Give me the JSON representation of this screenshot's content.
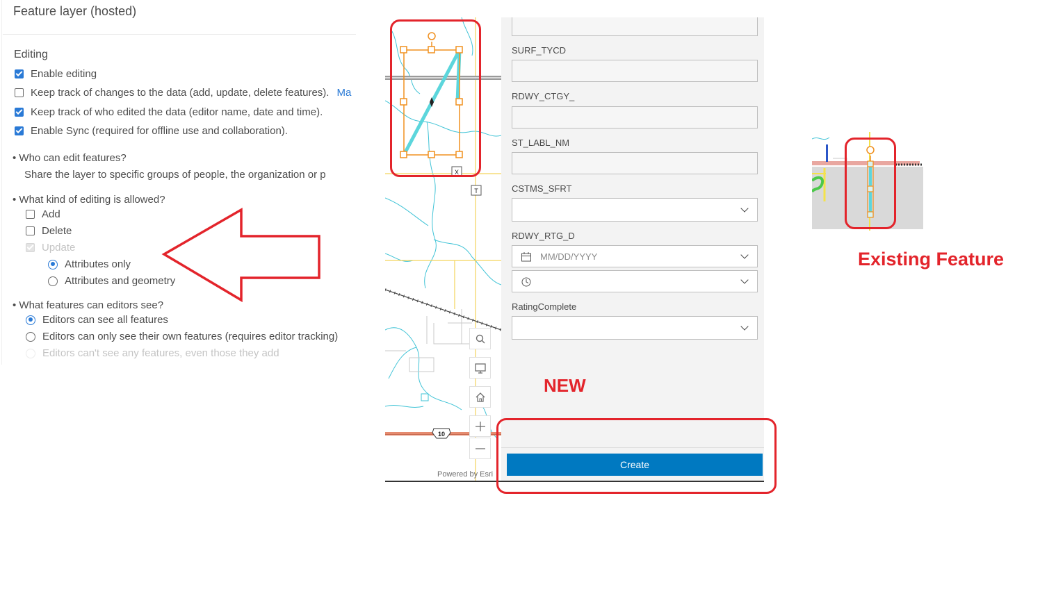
{
  "settings": {
    "title": "Feature layer (hosted)",
    "editing_heading": "Editing",
    "enable_editing": "Enable editing",
    "track_changes": "Keep track of changes to the data (add, update, delete features).",
    "track_changes_link": "Ma",
    "track_editor": "Keep track of who edited the data (editor name, date and time).",
    "enable_sync": "Enable Sync (required for offline use and collaboration).",
    "who_heading": "• Who can edit features?",
    "who_text": "Share the layer to specific groups of people, the organization or p",
    "kind_heading": "• What kind of editing is allowed?",
    "add": "Add",
    "delete": "Delete",
    "update": "Update",
    "attributes_only": "Attributes only",
    "attributes_geometry": "Attributes and geometry",
    "see_heading": "• What features can editors see?",
    "see_all": "Editors can see all features",
    "see_own": "Editors can only see their own features (requires editor tracking)",
    "see_none": "Editors can't see any features, even those they add"
  },
  "map": {
    "powered_by": "Powered by Esri",
    "route_shield": "10",
    "marker_x": "X",
    "marker_t": "T"
  },
  "form": {
    "fields": [
      {
        "label": "SURF_TYCD"
      },
      {
        "label": "RDWY_CTGY_"
      },
      {
        "label": "ST_LABL_NM"
      },
      {
        "label": "CSTMS_SFRT"
      },
      {
        "label": "RDWY_RTG_D"
      },
      {
        "label": "RatingComplete"
      }
    ],
    "date_placeholder": "MM/DD/YYYY",
    "create_label": "Create"
  },
  "annotations": {
    "new_label": "NEW",
    "existing_label": "Existing Feature"
  },
  "colors": {
    "accent": "#0079c1",
    "annotation_red": "#e3242b",
    "sketch_orange": "#f0901f",
    "sketch_cyan": "#5cd6dc"
  }
}
